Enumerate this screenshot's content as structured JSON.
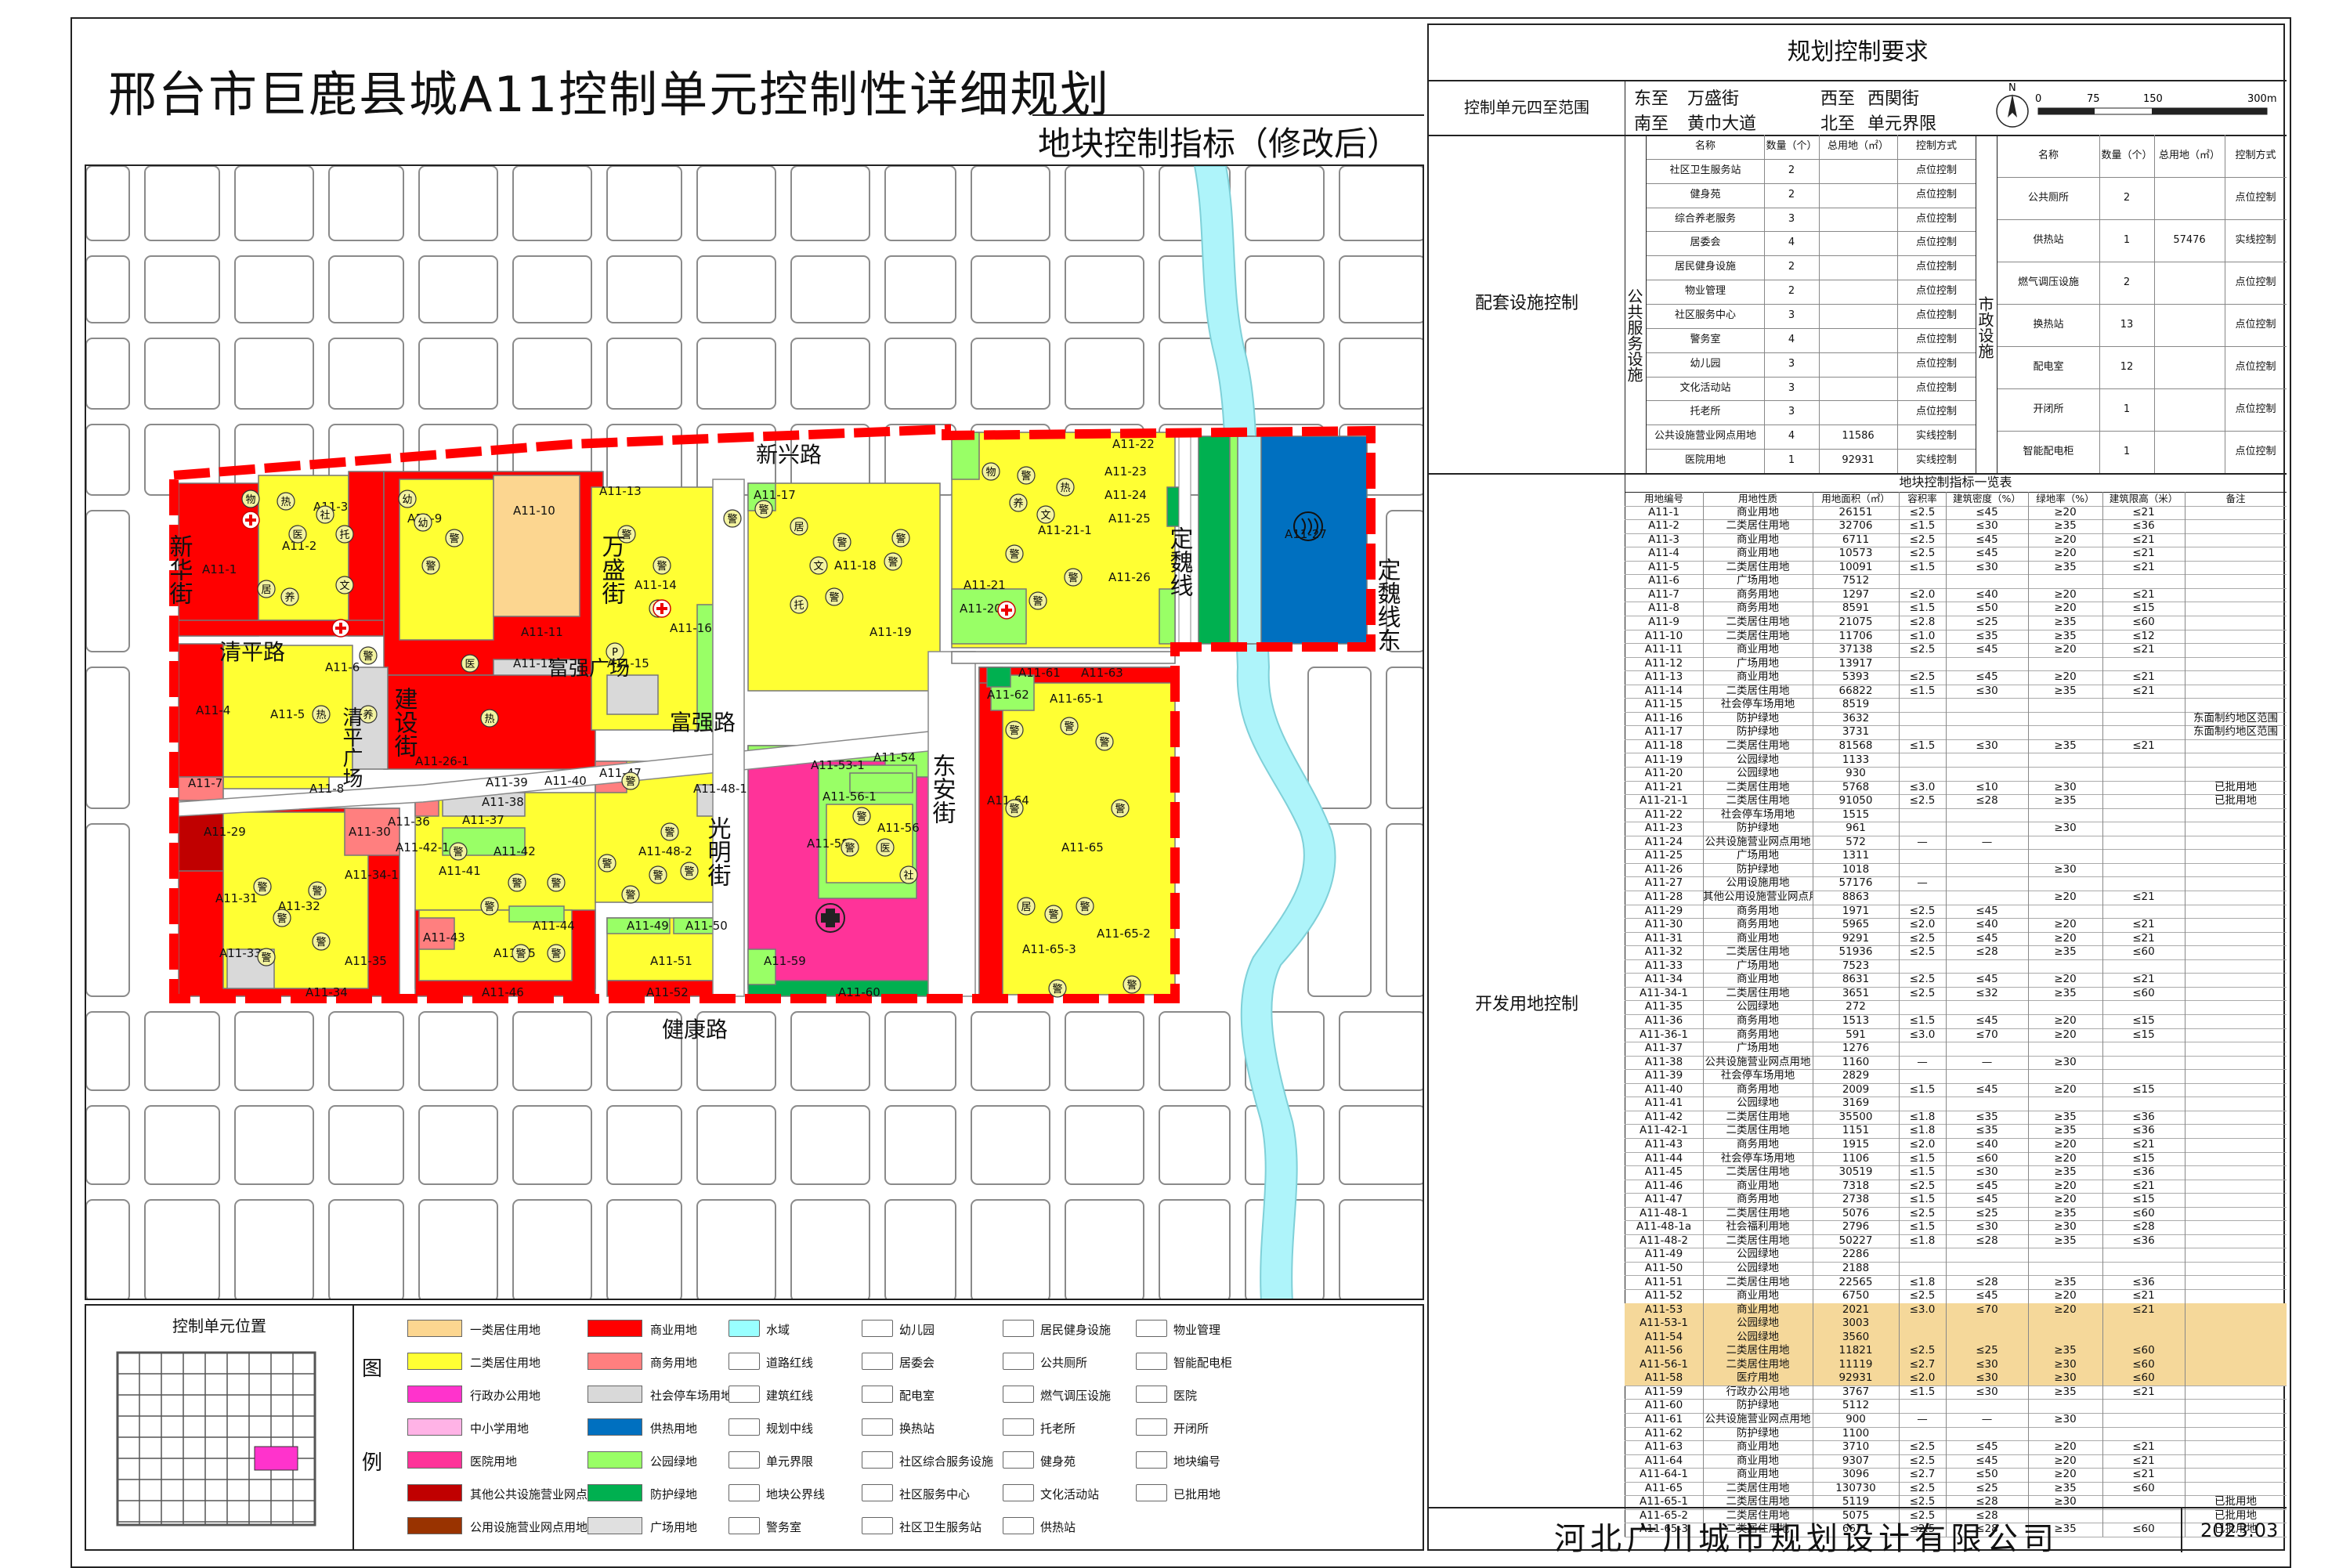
{
  "title": "邢台市巨鹿县城A11控制单元控制性详细规划",
  "subtitle": "地块控制指标（修改后）",
  "right_header": "规划控制要求",
  "boundary": {
    "label": "控制单元四至范围",
    "east_k": "东至",
    "east_v": "万盛街",
    "west_k": "西至",
    "west_v": "西関街",
    "south_k": "南至",
    "south_v": "黄巾大道",
    "north_k": "北至",
    "north_v": "单元界限"
  },
  "scale": {
    "n": "N",
    "t0": "0",
    "t1": "75",
    "t2": "150",
    "t3": "300m"
  },
  "facility_section_label": "配套设施控制",
  "public_label": "公共服务设施",
  "municipal_label": "市政设施",
  "fac_headers": [
    "名称",
    "数量（个）",
    "总用地（㎡）",
    "控制方式"
  ],
  "public_facilities": [
    [
      "社区卫生服务站",
      "2",
      "",
      "点位控制"
    ],
    [
      "健身苑",
      "2",
      "",
      "点位控制"
    ],
    [
      "综合养老服务",
      "3",
      "",
      "点位控制"
    ],
    [
      "居委会",
      "4",
      "",
      "点位控制"
    ],
    [
      "居民健身设施",
      "2",
      "",
      "点位控制"
    ],
    [
      "物业管理",
      "2",
      "",
      "点位控制"
    ],
    [
      "社区服务中心",
      "3",
      "",
      "点位控制"
    ],
    [
      "警务室",
      "4",
      "",
      "点位控制"
    ],
    [
      "幼儿园",
      "3",
      "",
      "点位控制"
    ],
    [
      "文化活动站",
      "3",
      "",
      "点位控制"
    ],
    [
      "托老所",
      "3",
      "",
      "点位控制"
    ],
    [
      "公共设施营业网点用地",
      "4",
      "11586",
      "实线控制"
    ],
    [
      "医院用地",
      "1",
      "92931",
      "实线控制"
    ]
  ],
  "municipal_facilities": [
    [
      "公共厕所",
      "2",
      "",
      "点位控制"
    ],
    [
      "供热站",
      "1",
      "57476",
      "实线控制"
    ],
    [
      "燃气调压设施",
      "2",
      "",
      "点位控制"
    ],
    [
      "换热站",
      "13",
      "",
      "点位控制"
    ],
    [
      "配电室",
      "12",
      "",
      "点位控制"
    ],
    [
      "开闭所",
      "1",
      "",
      "点位控制"
    ],
    [
      "智能配电柜",
      "1",
      "",
      "点位控制"
    ]
  ],
  "dev_section_label": "开发用地控制",
  "index_table_title": "地块控制指标一览表",
  "index_headers": [
    "用地编号",
    "用地性质",
    "用地面积（㎡）",
    "容积率",
    "建筑密度（%）",
    "绿地率（%）",
    "建筑限高（米）",
    "备注"
  ],
  "index_rows": [
    [
      "A11-1",
      "商业用地",
      "26151",
      "≤2.5",
      "≤45",
      "≥20",
      "≤21",
      ""
    ],
    [
      "A11-2",
      "二类居住用地",
      "32706",
      "≤1.5",
      "≤30",
      "≥35",
      "≤36",
      ""
    ],
    [
      "A11-3",
      "商业用地",
      "6711",
      "≤2.5",
      "≤45",
      "≥20",
      "≤21",
      ""
    ],
    [
      "A11-4",
      "商业用地",
      "10573",
      "≤2.5",
      "≤45",
      "≥20",
      "≤21",
      ""
    ],
    [
      "A11-5",
      "二类居住用地",
      "10091",
      "≤1.5",
      "≤30",
      "≥35",
      "≤21",
      ""
    ],
    [
      "A11-6",
      "广场用地",
      "7512",
      "",
      "",
      "",
      "",
      ""
    ],
    [
      "A11-7",
      "商务用地",
      "1297",
      "≤2.0",
      "≤40",
      "≥20",
      "≤21",
      ""
    ],
    [
      "A11-8",
      "商务用地",
      "8591",
      "≤1.5",
      "≤50",
      "≥20",
      "≤15",
      ""
    ],
    [
      "A11-9",
      "二类居住用地",
      "21075",
      "≤2.8",
      "≤25",
      "≥35",
      "≤60",
      ""
    ],
    [
      "A11-10",
      "二类居住用地",
      "11706",
      "≤1.0",
      "≤35",
      "≥35",
      "≤12",
      ""
    ],
    [
      "A11-11",
      "商业用地",
      "37138",
      "≤2.5",
      "≤45",
      "≥20",
      "≤21",
      ""
    ],
    [
      "A11-12",
      "广场用地",
      "13917",
      "",
      "",
      "",
      "",
      ""
    ],
    [
      "A11-13",
      "商业用地",
      "5393",
      "≤2.5",
      "≤45",
      "≥20",
      "≤21",
      ""
    ],
    [
      "A11-14",
      "二类居住用地",
      "66822",
      "≤1.5",
      "≤30",
      "≥35",
      "≤21",
      ""
    ],
    [
      "A11-15",
      "社会停车场用地",
      "8519",
      "",
      "",
      "",
      "",
      ""
    ],
    [
      "A11-16",
      "防护绿地",
      "3632",
      "",
      "",
      "",
      "",
      "东面制约地区范围"
    ],
    [
      "A11-17",
      "防护绿地",
      "3731",
      "",
      "",
      "",
      "",
      "东面制约地区范围"
    ],
    [
      "A11-18",
      "二类居住用地",
      "81568",
      "≤1.5",
      "≤30",
      "≥35",
      "≤21",
      ""
    ],
    [
      "A11-19",
      "公园绿地",
      "1133",
      "",
      "",
      "",
      "",
      ""
    ],
    [
      "A11-20",
      "公园绿地",
      "930",
      "",
      "",
      "",
      "",
      ""
    ],
    [
      "A11-21",
      "二类居住用地",
      "5768",
      "≤3.0",
      "≤10",
      "≥30",
      "",
      "已批用地"
    ],
    [
      "A11-21-1",
      "二类居住用地",
      "91050",
      "≤2.5",
      "≤28",
      "≥35",
      "",
      "已批用地"
    ],
    [
      "A11-22",
      "社会停车场用地",
      "1515",
      "",
      "",
      "",
      "",
      ""
    ],
    [
      "A11-23",
      "防护绿地",
      "961",
      "",
      "",
      "≥30",
      "",
      ""
    ],
    [
      "A11-24",
      "公共设施营业网点用地",
      "572",
      "—",
      "—",
      "",
      "",
      ""
    ],
    [
      "A11-25",
      "广场用地",
      "1311",
      "",
      "",
      "",
      "",
      ""
    ],
    [
      "A11-26",
      "防护绿地",
      "1018",
      "",
      "",
      "≥30",
      "",
      ""
    ],
    [
      "A11-27",
      "公用设施用地",
      "57176",
      "—",
      "",
      "",
      "",
      ""
    ],
    [
      "A11-28",
      "其他公用设施营业网点用地",
      "8863",
      "",
      "",
      "≥20",
      "≤21",
      ""
    ],
    [
      "A11-29",
      "商务用地",
      "1971",
      "≤2.5",
      "≤45",
      "",
      "",
      ""
    ],
    [
      "A11-30",
      "商务用地",
      "5965",
      "≤2.0",
      "≤40",
      "≥20",
      "≤21",
      ""
    ],
    [
      "A11-31",
      "商业用地",
      "9291",
      "≤2.5",
      "≤45",
      "≥20",
      "≤21",
      ""
    ],
    [
      "A11-32",
      "二类居住用地",
      "51936",
      "≤2.5",
      "≤28",
      "≥35",
      "≤60",
      ""
    ],
    [
      "A11-33",
      "广场用地",
      "7523",
      "",
      "",
      "",
      "",
      ""
    ],
    [
      "A11-34",
      "商业用地",
      "8631",
      "≤2.5",
      "≤45",
      "≥20",
      "≤21",
      ""
    ],
    [
      "A11-34-1",
      "二类居住用地",
      "3651",
      "≤2.5",
      "≤32",
      "≥35",
      "≤60",
      ""
    ],
    [
      "A11-35",
      "公园绿地",
      "272",
      "",
      "",
      "",
      "",
      ""
    ],
    [
      "A11-36",
      "商务用地",
      "1513",
      "≤1.5",
      "≤45",
      "≥20",
      "≤15",
      ""
    ],
    [
      "A11-36-1",
      "商务用地",
      "591",
      "≤3.0",
      "≤70",
      "≥20",
      "≤15",
      ""
    ],
    [
      "A11-37",
      "广场用地",
      "1276",
      "",
      "",
      "",
      "",
      ""
    ],
    [
      "A11-38",
      "公共设施营业网点用地",
      "1160",
      "—",
      "—",
      "≥30",
      "",
      ""
    ],
    [
      "A11-39",
      "社会停车场用地",
      "2829",
      "",
      "",
      "",
      "",
      ""
    ],
    [
      "A11-40",
      "商务用地",
      "2009",
      "≤1.5",
      "≤45",
      "≥20",
      "≤15",
      ""
    ],
    [
      "A11-41",
      "公园绿地",
      "3169",
      "",
      "",
      "",
      "",
      ""
    ],
    [
      "A11-42",
      "二类居住用地",
      "35500",
      "≤1.8",
      "≤35",
      "≥35",
      "≤36",
      ""
    ],
    [
      "A11-42-1",
      "二类居住用地",
      "1151",
      "≤1.8",
      "≤35",
      "≥35",
      "≤36",
      ""
    ],
    [
      "A11-43",
      "商务用地",
      "1915",
      "≤2.0",
      "≤40",
      "≥20",
      "≤21",
      ""
    ],
    [
      "A11-44",
      "社会停车场用地",
      "1106",
      "≤1.5",
      "≤60",
      "≥20",
      "≤15",
      ""
    ],
    [
      "A11-45",
      "二类居住用地",
      "30519",
      "≤1.5",
      "≤30",
      "≥35",
      "≤36",
      ""
    ],
    [
      "A11-46",
      "商业用地",
      "7318",
      "≤2.5",
      "≤45",
      "≥20",
      "≤21",
      ""
    ],
    [
      "A11-47",
      "商务用地",
      "2738",
      "≤1.5",
      "≤45",
      "≥20",
      "≤15",
      ""
    ],
    [
      "A11-48-1",
      "二类居住用地",
      "5076",
      "≤2.5",
      "≤25",
      "≥35",
      "≤60",
      ""
    ],
    [
      "A11-48-1a",
      "社会福利用地",
      "2796",
      "≤1.5",
      "≤30",
      "≥30",
      "≤28",
      ""
    ],
    [
      "A11-48-2",
      "二类居住用地",
      "50227",
      "≤1.8",
      "≤28",
      "≥35",
      "≤36",
      ""
    ],
    [
      "A11-49",
      "公园绿地",
      "2286",
      "",
      "",
      "",
      "",
      ""
    ],
    [
      "A11-50",
      "公园绿地",
      "2188",
      "",
      "",
      "",
      "",
      ""
    ],
    [
      "A11-51",
      "二类居住用地",
      "22565",
      "≤1.8",
      "≤28",
      "≥35",
      "≤36",
      ""
    ],
    [
      "A11-52",
      "商业用地",
      "6750",
      "≤2.5",
      "≤45",
      "≥20",
      "≤21",
      ""
    ],
    [
      "A11-53",
      "商业用地",
      "2021",
      "≤3.0",
      "≤70",
      "≥20",
      "≤21",
      ""
    ],
    [
      "A11-53-1",
      "公园绿地",
      "3003",
      "",
      "",
      "",
      "",
      ""
    ],
    [
      "A11-54",
      "公园绿地",
      "3560",
      "",
      "",
      "",
      "",
      ""
    ],
    [
      "A11-56",
      "二类居住用地",
      "11821",
      "≤2.5",
      "≤25",
      "≥35",
      "≤60",
      ""
    ],
    [
      "A11-56-1",
      "二类居住用地",
      "11119",
      "≤2.7",
      "≤30",
      "≥30",
      "≤60",
      ""
    ],
    [
      "A11-58",
      "医疗用地",
      "92931",
      "≤2.0",
      "≤30",
      "≥30",
      "≤60",
      ""
    ],
    [
      "A11-59",
      "行政办公用地",
      "3767",
      "≤1.5",
      "≤30",
      "≥35",
      "≤21",
      ""
    ],
    [
      "A11-60",
      "防护绿地",
      "5112",
      "",
      "",
      "",
      "",
      ""
    ],
    [
      "A11-61",
      "公共设施营业网点用地",
      "900",
      "—",
      "—",
      "≥30",
      "",
      ""
    ],
    [
      "A11-62",
      "防护绿地",
      "1100",
      "",
      "",
      "",
      "",
      ""
    ],
    [
      "A11-63",
      "商业用地",
      "3710",
      "≤2.5",
      "≤45",
      "≥20",
      "≤21",
      ""
    ],
    [
      "A11-64",
      "商业用地",
      "9307",
      "≤2.5",
      "≤45",
      "≥20",
      "≤21",
      ""
    ],
    [
      "A11-64-1",
      "商业用地",
      "3096",
      "≤2.7",
      "≤50",
      "≥20",
      "≤21",
      ""
    ],
    [
      "A11-65",
      "二类居住用地",
      "130730",
      "≤2.5",
      "≤25",
      "≥35",
      "≤60",
      ""
    ],
    [
      "A11-65-1",
      "二类居住用地",
      "5119",
      "≤2.5",
      "≤28",
      "≥30",
      "",
      "已批用地"
    ],
    [
      "A11-65-2",
      "二类居住用地",
      "5075",
      "≤2.5",
      "≤28",
      "",
      "",
      "已批用地"
    ],
    [
      "A11-65-3",
      "二类居住用地",
      "6671",
      "≤2.5",
      "≤28",
      "≥35",
      "≤60",
      "已批用地"
    ]
  ],
  "company": "河北广川城市规划设计有限公司",
  "date": "2023.03",
  "locator_title": "控制单元位置",
  "legend_title_1": "图",
  "legend_title_2": "例",
  "legend": [
    [
      "一类居住用地",
      "#fcd690"
    ],
    [
      "二类居住用地",
      "#ffff33"
    ],
    [
      "行政办公用地",
      "#ff33cc"
    ],
    [
      "中小学用地",
      "#ffb3e6"
    ],
    [
      "医院用地",
      "#ff3399"
    ],
    [
      "其他公共设施营业网点用地",
      "#c00000"
    ],
    [
      "公用设施营业网点用地",
      "#993300"
    ],
    [
      "商业用地",
      "#ff0000"
    ],
    [
      "商务用地",
      "#ff7f7f"
    ],
    [
      "社会停车场用地",
      "#d9d9d9"
    ],
    [
      "供热用地",
      "#0070c0"
    ],
    [
      "公园绿地",
      "#99ff66"
    ],
    [
      "防护绿地",
      "#00b050"
    ],
    [
      "广场用地",
      "#e0e0e0"
    ],
    [
      "水域",
      "#99ffff"
    ],
    [
      "道路红线",
      "#ffffff"
    ],
    [
      "建筑红线",
      "#ffffff"
    ],
    [
      "规划中线",
      "#ffffff"
    ],
    [
      "单元界限",
      "#ffffff"
    ],
    [
      "地块公界线",
      "#ffffff"
    ],
    [
      "警务室",
      "#ffffff"
    ],
    [
      "幼儿园",
      "#ffffff"
    ],
    [
      "居委会",
      "#ffffff"
    ],
    [
      "配电室",
      "#ffffff"
    ],
    [
      "换热站",
      "#ffffff"
    ],
    [
      "社区综合服务设施",
      "#ffffff"
    ],
    [
      "社区服务中心",
      "#ffffff"
    ],
    [
      "社区卫生服务站",
      "#ffffff"
    ],
    [
      "居民健身设施",
      "#ffffff"
    ],
    [
      "公共厕所",
      "#ffffff"
    ],
    [
      "燃气调压设施",
      "#ffffff"
    ],
    [
      "托老所",
      "#ffffff"
    ],
    [
      "健身苑",
      "#ffffff"
    ],
    [
      "文化活动站",
      "#ffffff"
    ],
    [
      "供热站",
      "#ffffff"
    ],
    [
      "物业管理",
      "#ffffff"
    ],
    [
      "智能配电柜",
      "#ffffff"
    ],
    [
      "医院",
      "#ffffff"
    ],
    [
      "开闭所",
      "#ffffff"
    ],
    [
      "地块编号",
      "#ffffff"
    ],
    [
      "已批用地",
      "#ffffff"
    ]
  ],
  "legend_sample_code": "A11-64",
  "streets": {
    "xinxing": "新兴路",
    "qingping": "清平路",
    "fuqiang": "富强路",
    "jiankang": "健康路",
    "xinhua": "新华街",
    "jianshe": "建设街",
    "wansheng": "万盛街",
    "dongan": "东安街",
    "guangming": "光明街",
    "dingwei": "定魏线",
    "dingwei_dong": "定魏线东",
    "qingping_sq": "清平广场",
    "fuqiang_sq": "富强广场"
  },
  "parcel_labels": [
    "A11-1",
    "A11-2",
    "A11-3",
    "A11-4",
    "A11-5",
    "A11-6",
    "A11-7",
    "A11-8",
    "A11-9",
    "A11-10",
    "A11-11",
    "A11-12",
    "A11-13",
    "A11-14",
    "A11-15",
    "A11-16",
    "A11-17",
    "A11-18",
    "A11-19",
    "A11-20",
    "A11-21",
    "A11-21-1",
    "A11-22",
    "A11-23",
    "A11-24",
    "A11-25",
    "A11-26",
    "A11-27",
    "A11-29",
    "A11-30",
    "A11-31",
    "A11-32",
    "A11-33",
    "A11-34",
    "A11-34-1",
    "A11-35",
    "A11-36",
    "A11-37",
    "A11-38",
    "A11-39",
    "A11-40",
    "A11-41",
    "A11-42",
    "A11-42-1",
    "A11-43",
    "A11-44",
    "A11-45",
    "A11-46",
    "A11-47",
    "A11-48-1",
    "A11-48-2",
    "A11-49",
    "A11-50",
    "A11-51",
    "A11-52",
    "A11-53-1",
    "A11-54",
    "A11-56",
    "A11-56-1",
    "A11-58",
    "A11-59",
    "A11-60",
    "A11-61",
    "A11-62",
    "A11-63",
    "A11-64",
    "A11-65",
    "A11-65-1",
    "A11-65-2",
    "A11-65-3",
    "A11-26-1"
  ],
  "fac_icons": [
    "物",
    "热",
    "托",
    "居",
    "警",
    "幼",
    "文",
    "养",
    "社",
    "健",
    "医",
    "P"
  ]
}
